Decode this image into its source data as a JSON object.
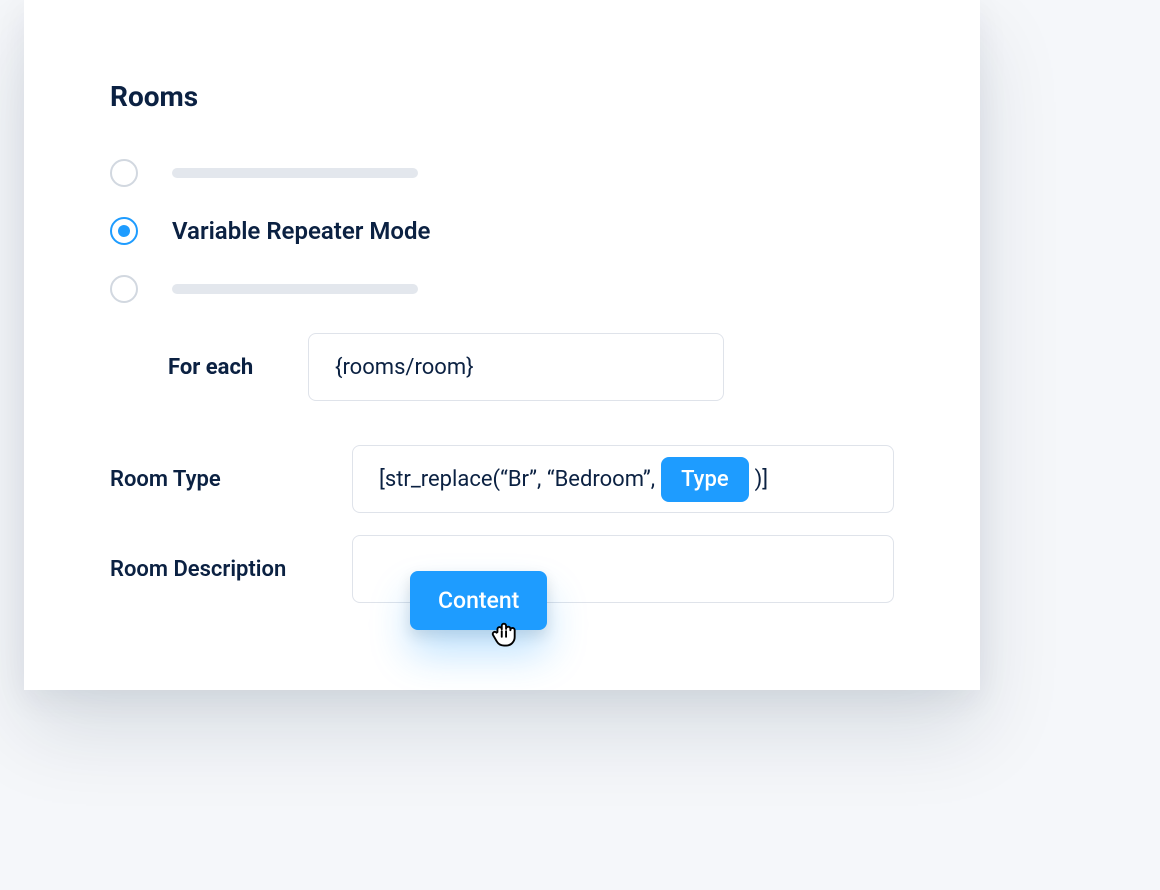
{
  "section": {
    "title": "Rooms"
  },
  "radios": {
    "selected_label": "Variable Repeater Mode"
  },
  "foreach": {
    "label": "For each",
    "value": "{rooms/room}"
  },
  "fields": {
    "room_type": {
      "label": "Room Type",
      "expr_prefix": "[str_replace(“Br”, “Bedroom”,",
      "chip": "Type",
      "expr_suffix": ")]"
    },
    "room_description": {
      "label": "Room Description",
      "drag_chip": "Content"
    }
  },
  "colors": {
    "accent": "#1e9cff",
    "text": "#0b2142",
    "muted": "#e3e7ed",
    "border": "#dfe3ea"
  }
}
